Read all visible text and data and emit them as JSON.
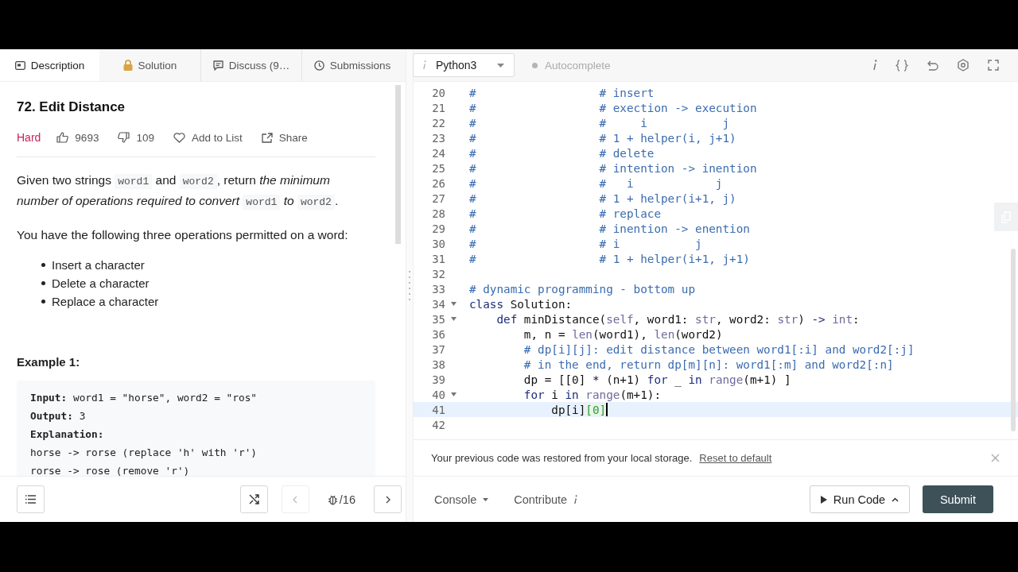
{
  "tabs": [
    {
      "label": "Description",
      "selected": true
    },
    {
      "label": "Solution",
      "selected": false
    },
    {
      "label": "Discuss (9…",
      "selected": false
    },
    {
      "label": "Submissions",
      "selected": false
    }
  ],
  "problem": {
    "title": "72. Edit Distance",
    "difficulty": "Hard",
    "likes": "9693",
    "dislikes": "109",
    "add_to_list": "Add to List",
    "share": "Share",
    "paragraphs": [
      [
        {
          "kind": "text",
          "text": "Given two strings "
        },
        {
          "kind": "code",
          "text": "word1"
        },
        {
          "kind": "text",
          "text": " and "
        },
        {
          "kind": "code",
          "text": "word2"
        },
        {
          "kind": "text",
          "text": ", return "
        },
        {
          "kind": "italic",
          "text": "the minimum number of operations required to convert "
        },
        {
          "kind": "code",
          "text": "word1"
        },
        {
          "kind": "italic",
          "text": " to "
        },
        {
          "kind": "code",
          "text": "word2"
        },
        {
          "kind": "text",
          "text": "."
        }
      ],
      [
        {
          "kind": "text",
          "text": "You have the following three operations permitted on a word:"
        }
      ]
    ],
    "bullets": [
      "Insert a character",
      "Delete a character",
      "Replace a character"
    ],
    "example": {
      "heading": "Example 1:",
      "lines": [
        {
          "label": "Input:",
          "text": " word1 = \"horse\", word2 = \"ros\""
        },
        {
          "label": "Output:",
          "text": " 3"
        },
        {
          "label": "Explanation:"
        },
        {
          "text": "horse -> rorse (replace 'h' with 'r')"
        },
        {
          "text": "rorse -> rose (remove 'r')"
        }
      ]
    }
  },
  "pager": {
    "counter": "/16",
    "prev_disabled": true,
    "next_disabled": false
  },
  "editor": {
    "language": "Python3",
    "autocomplete": {
      "label": "Autocomplete",
      "on": false
    },
    "lines": [
      {
        "number": "20",
        "fold": false,
        "current": false,
        "tokens": [
          {
            "kind": "comment",
            "text": "#                  # insert"
          }
        ]
      },
      {
        "number": "21",
        "fold": false,
        "current": false,
        "tokens": [
          {
            "kind": "comment",
            "text": "#                  # exection -> execution"
          }
        ]
      },
      {
        "number": "22",
        "fold": false,
        "current": false,
        "tokens": [
          {
            "kind": "comment",
            "text": "#                  #     i           j"
          }
        ]
      },
      {
        "number": "23",
        "fold": false,
        "current": false,
        "tokens": [
          {
            "kind": "comment",
            "text": "#                  # 1 + helper(i, j+1)"
          }
        ]
      },
      {
        "number": "24",
        "fold": false,
        "current": false,
        "tokens": [
          {
            "kind": "comment",
            "text": "#                  # delete"
          }
        ]
      },
      {
        "number": "25",
        "fold": false,
        "current": false,
        "tokens": [
          {
            "kind": "comment",
            "text": "#                  # intention -> inention"
          }
        ]
      },
      {
        "number": "26",
        "fold": false,
        "current": false,
        "tokens": [
          {
            "kind": "comment",
            "text": "#                  #   i            j"
          }
        ]
      },
      {
        "number": "27",
        "fold": false,
        "current": false,
        "tokens": [
          {
            "kind": "comment",
            "text": "#                  # 1 + helper(i+1, j)"
          }
        ]
      },
      {
        "number": "28",
        "fold": false,
        "current": false,
        "tokens": [
          {
            "kind": "comment",
            "text": "#                  # replace"
          }
        ]
      },
      {
        "number": "29",
        "fold": false,
        "current": false,
        "tokens": [
          {
            "kind": "comment",
            "text": "#                  # inention -> enention"
          }
        ]
      },
      {
        "number": "30",
        "fold": false,
        "current": false,
        "tokens": [
          {
            "kind": "comment",
            "text": "#                  # i           j"
          }
        ]
      },
      {
        "number": "31",
        "fold": false,
        "current": false,
        "tokens": [
          {
            "kind": "comment",
            "text": "#                  # 1 + helper(i+1, j+1)"
          }
        ]
      },
      {
        "number": "32",
        "fold": false,
        "current": false
      },
      {
        "number": "33",
        "fold": false,
        "current": false,
        "tokens": [
          {
            "kind": "comment",
            "text": "# dynamic programming - bottom up"
          }
        ]
      },
      {
        "number": "34",
        "fold": true,
        "current": false,
        "tokens": [
          {
            "kind": "keyword",
            "text": "class"
          },
          {
            "kind": "plain",
            "text": " Solution:"
          }
        ]
      },
      {
        "number": "35",
        "fold": true,
        "current": false,
        "tokens": [
          {
            "kind": "keyword",
            "text": "    def"
          },
          {
            "kind": "plain",
            "text": " minDistance("
          },
          {
            "kind": "builtin",
            "text": "self"
          },
          {
            "kind": "plain",
            "text": ", word1: "
          },
          {
            "kind": "builtin",
            "text": "str"
          },
          {
            "kind": "plain",
            "text": ", word2: "
          },
          {
            "kind": "builtin",
            "text": "str"
          },
          {
            "kind": "plain",
            "text": ") "
          },
          {
            "kind": "keyword",
            "text": "->"
          },
          {
            "kind": "builtin",
            "text": " int"
          },
          {
            "kind": "plain",
            "text": ":"
          }
        ]
      },
      {
        "number": "36",
        "fold": false,
        "current": false,
        "tokens": [
          {
            "kind": "plain",
            "text": "        m, n = "
          },
          {
            "kind": "builtin",
            "text": "len"
          },
          {
            "kind": "plain",
            "text": "(word1), "
          },
          {
            "kind": "builtin",
            "text": "len"
          },
          {
            "kind": "plain",
            "text": "(word2)"
          }
        ]
      },
      {
        "number": "37",
        "fold": false,
        "current": false,
        "tokens": [
          {
            "kind": "comment",
            "text": "        # dp[i][j]: edit distance between word1[:i] and word2[:j]"
          }
        ]
      },
      {
        "number": "38",
        "fold": false,
        "current": false,
        "tokens": [
          {
            "kind": "comment",
            "text": "        # in the end, return dp[m][n]: word1[:m] and word2[:n]"
          }
        ]
      },
      {
        "number": "39",
        "fold": false,
        "current": false,
        "tokens": [
          {
            "kind": "plain",
            "text": "        dp = [[0] * (n+1) "
          },
          {
            "kind": "keyword",
            "text": "for"
          },
          {
            "kind": "plain",
            "text": " _ "
          },
          {
            "kind": "keyword",
            "text": "in"
          },
          {
            "kind": "builtin",
            "text": " range"
          },
          {
            "kind": "plain",
            "text": "(m+1) ]"
          }
        ]
      },
      {
        "number": "40",
        "fold": true,
        "current": false,
        "tokens": [
          {
            "kind": "keyword",
            "text": "        for"
          },
          {
            "kind": "plain",
            "text": " i "
          },
          {
            "kind": "keyword",
            "text": "in"
          },
          {
            "kind": "builtin",
            "text": " range"
          },
          {
            "kind": "plain",
            "text": "(m+1):"
          }
        ]
      },
      {
        "number": "41",
        "fold": false,
        "current": true,
        "tokens": [
          {
            "kind": "plain",
            "text": "            dp[i]"
          },
          {
            "kind": "match",
            "text": "[0]"
          }
        ]
      },
      {
        "number": "42",
        "fold": false,
        "current": false
      }
    ]
  },
  "notice": {
    "text": "Your previous code was restored from your local storage.",
    "link": "Reset to default"
  },
  "footer": {
    "console": "Console",
    "contribute": "Contribute",
    "run": "Run Code",
    "submit": "Submit"
  }
}
